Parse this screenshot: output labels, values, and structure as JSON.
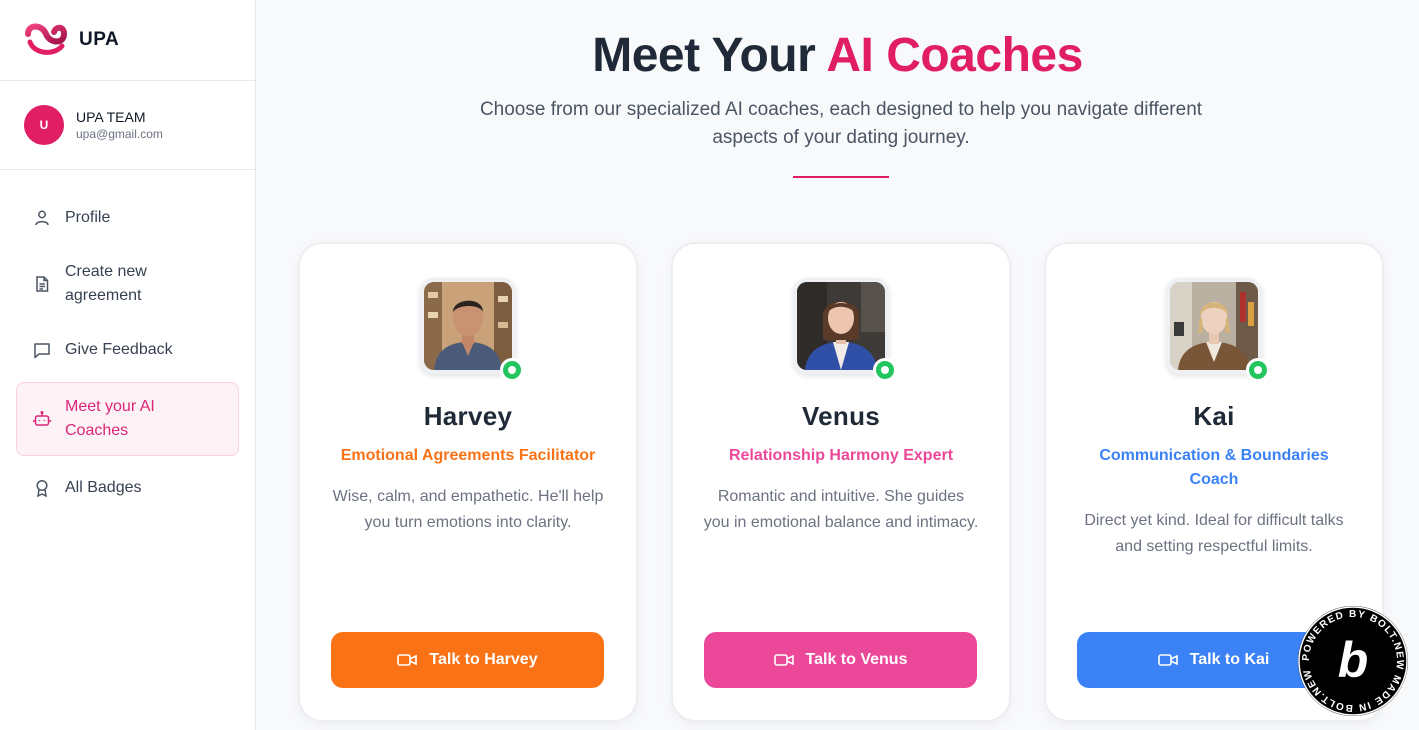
{
  "brand": {
    "name": "UPA"
  },
  "user": {
    "initial": "U",
    "name": "UPA TEAM",
    "email": "upa@gmail.com"
  },
  "nav": [
    {
      "label": "Profile",
      "icon": "user-icon"
    },
    {
      "label": "Create new agreement",
      "icon": "document-icon"
    },
    {
      "label": "Give Feedback",
      "icon": "message-icon"
    },
    {
      "label": "Meet your AI Coaches",
      "icon": "bot-icon",
      "active": true
    },
    {
      "label": "All Badges",
      "icon": "award-icon"
    }
  ],
  "header": {
    "title_prefix": "Meet Your ",
    "title_accent": "AI Coaches",
    "subtitle": "Choose from our specialized AI coaches, each designed to help you navigate different aspects of your dating journey."
  },
  "coaches": [
    {
      "name": "Harvey",
      "role": "Emotional Agreements Facilitator",
      "description": "Wise, calm, and empathetic. He'll help you turn emotions into clarity.",
      "button": "Talk to Harvey",
      "color": "#f97316"
    },
    {
      "name": "Venus",
      "role": "Relationship Harmony Expert",
      "description": "Romantic and intuitive. She guides you in emotional balance and intimacy.",
      "button": "Talk to Venus",
      "color": "#ec4899"
    },
    {
      "name": "Kai",
      "role": "Communication & Boundaries Coach",
      "description": "Direct yet kind. Ideal for difficult talks and setting respectful limits.",
      "button": "Talk to Kai",
      "color": "#3b82f6"
    }
  ],
  "badge": {
    "text": "POWERED BY BOLT.NEW MADE IN BOLT.NEW",
    "letter": "b"
  },
  "colors": {
    "accent": "#e11d63",
    "online": "#22c55e"
  }
}
